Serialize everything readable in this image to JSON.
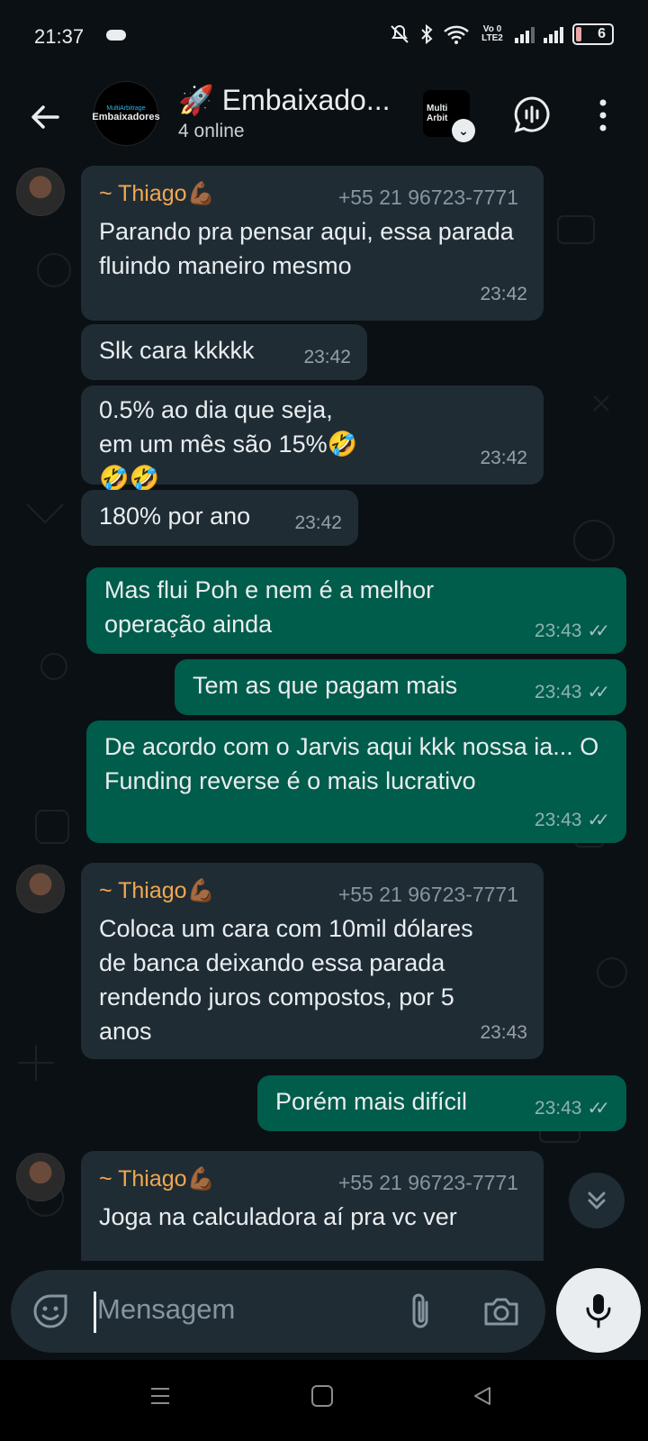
{
  "status_bar": {
    "time": "21:37",
    "volte_label": "Vo 0 LTE2",
    "battery": "6"
  },
  "header": {
    "title": "🚀 Embaixado...",
    "subtitle": "4 online",
    "group_avatar_small": "MultiArbitrage",
    "group_avatar_big": "Embaixadores",
    "app_badge_line1": "Multi",
    "app_badge_line2": "Arbit"
  },
  "messages": [
    {
      "sender": "~ Thiago💪🏾",
      "phone": "+55 21 96723-7771",
      "text": "Parando pra pensar aqui, essa parada fluindo maneiro mesmo",
      "time": "23:42"
    },
    {
      "text": "Slk cara kkkkk",
      "time": "23:42"
    },
    {
      "text": "0.5% ao dia que seja, em um mês são 15%🤣🤣🤣",
      "time": "23:42"
    },
    {
      "text": "180% por ano",
      "time": "23:42"
    },
    {
      "text": "Mas flui Poh e nem é a melhor operação ainda",
      "time": "23:43"
    },
    {
      "text": "Tem as que pagam mais",
      "time": "23:43"
    },
    {
      "text": "De acordo com o Jarvis aqui kkk nossa ia... O Funding reverse é o mais lucrativo",
      "time": "23:43"
    },
    {
      "sender": "~ Thiago💪🏾",
      "phone": "+55 21 96723-7771",
      "text": "Coloca um cara com 10mil dólares de banca deixando essa parada rendendo juros compostos, por 5 anos",
      "time": "23:43"
    },
    {
      "text": "Porém mais difícil",
      "time": "23:43"
    },
    {
      "sender": "~ Thiago💪🏾",
      "phone": "+55 21 96723-7771",
      "text": "Joga na calculadora aí pra vc ver"
    }
  ],
  "input": {
    "placeholder": "Mensagem"
  },
  "colors": {
    "incoming_bubble": "#1f2c34",
    "outgoing_bubble": "#005c4b",
    "sender_name": "#f3a74f"
  }
}
